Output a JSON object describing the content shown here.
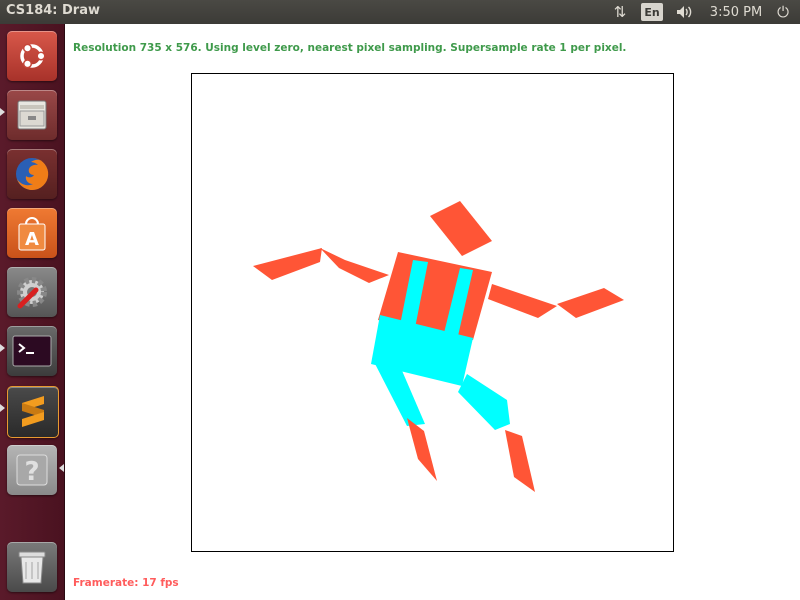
{
  "window": {
    "title": "CS184: Draw"
  },
  "panel": {
    "network_icon": "network-updown-icon",
    "language": "En",
    "volume_icon": "speaker-icon",
    "clock": "3:50 PM",
    "power_icon": "power-icon"
  },
  "launcher": {
    "items": [
      {
        "name": "ubuntu-dash",
        "icon": "ubuntu-logo-icon",
        "color": "#c4463a"
      },
      {
        "name": "files",
        "icon": "file-cabinet-icon",
        "color": "#8b3a3a"
      },
      {
        "name": "firefox",
        "icon": "firefox-icon",
        "color": "#6b2a2a"
      },
      {
        "name": "software-center",
        "icon": "shopping-bag-icon",
        "color": "#e0641f"
      },
      {
        "name": "system-settings",
        "icon": "settings-wrench-icon",
        "color": "#666666"
      },
      {
        "name": "terminal",
        "icon": "terminal-icon",
        "color": "#2e2e2e"
      },
      {
        "name": "sublime-text",
        "icon": "sublime-icon",
        "color": "#3a3a3a"
      },
      {
        "name": "help",
        "icon": "question-mark-icon",
        "color": "#9a9a9a"
      },
      {
        "name": "trash",
        "icon": "trash-icon",
        "color": "#777777"
      }
    ]
  },
  "app": {
    "status": "Resolution 735 x 576. Using level zero, nearest pixel sampling. Supersample rate 1 per pixel.",
    "framerate_label": "Framerate: 17 fps",
    "colors": {
      "body": "#ff5536",
      "pants": "#00ffff",
      "status_text": "#3f9a4b",
      "framerate_text": "#ff5c5c"
    }
  }
}
